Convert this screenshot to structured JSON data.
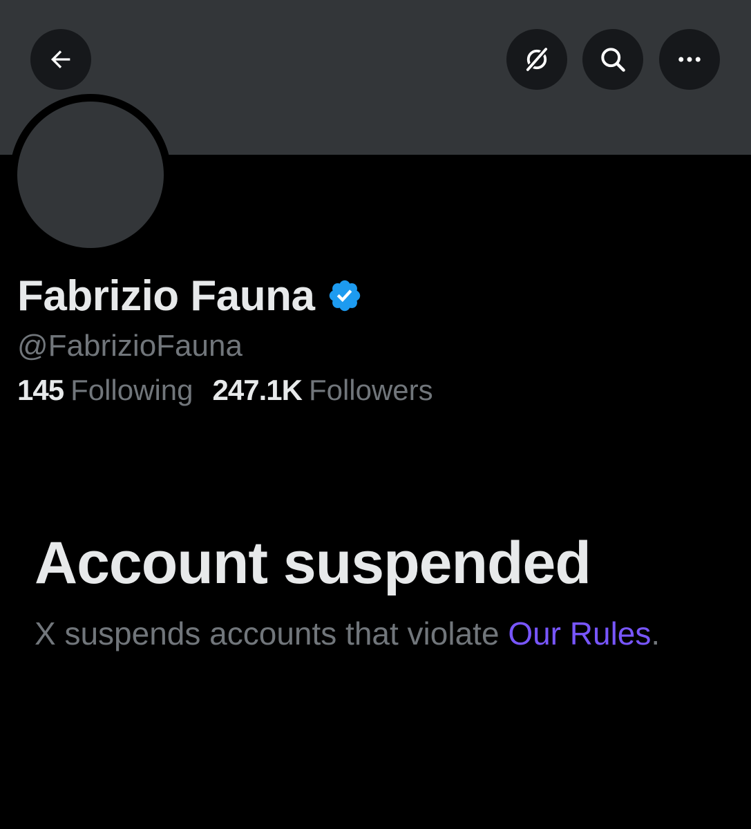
{
  "header": {
    "back_icon": "arrow-left-icon",
    "grok_icon": "grok-icon",
    "search_icon": "search-icon",
    "more_icon": "more-horizontal-icon"
  },
  "profile": {
    "display_name": "Fabrizio Fauna",
    "verified_icon": "verified-badge-icon",
    "handle": "@FabrizioFauna",
    "following_count": "145",
    "following_label": "Following",
    "followers_count": "247.1K",
    "followers_label": "Followers"
  },
  "suspension": {
    "title": "Account suspended",
    "message": "X suspends accounts that violate ",
    "link_text": "Our Rules",
    "message_end": "."
  },
  "colors": {
    "background": "#000000",
    "banner": "#333639",
    "primary_text": "#e7e9ea",
    "secondary_text": "#71767b",
    "link": "#7856ff",
    "verified": "#1d9bf0"
  }
}
